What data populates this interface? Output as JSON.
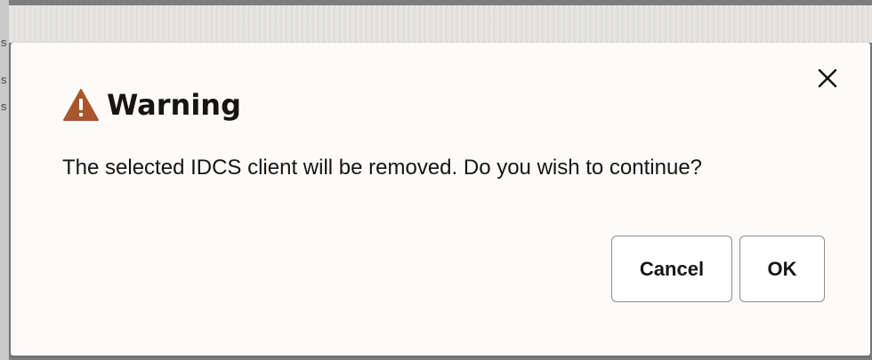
{
  "underlay": {
    "fragments": [
      "s",
      "s",
      "s"
    ]
  },
  "dialog": {
    "title": "Warning",
    "icon": "warning-triangle-icon",
    "message": "The selected IDCS client will be removed. Do you wish to continue?",
    "close_icon": "close-icon",
    "buttons": {
      "cancel_label": "Cancel",
      "ok_label": "OK"
    }
  },
  "colors": {
    "warning_icon": "#a8562a",
    "text": "#161513",
    "dialog_background": "#fcfbfa",
    "button_border": "#8f8c88"
  }
}
